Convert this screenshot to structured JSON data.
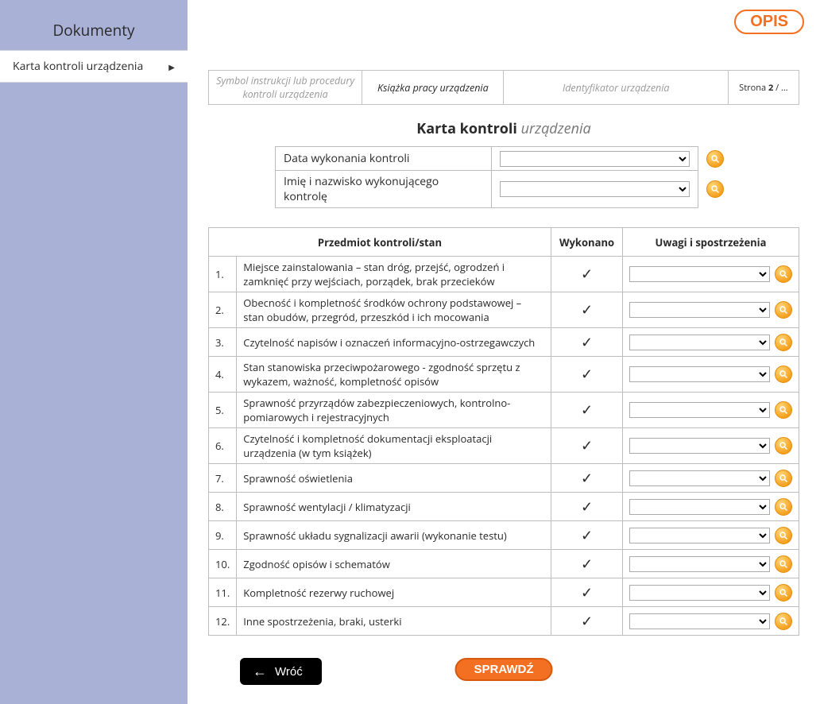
{
  "sidebar": {
    "title": "Dokumenty",
    "item": "Karta kontroli urządzenia"
  },
  "opis": "OPIS",
  "header_row": {
    "c1": "Symbol instrukcji lub procedury kontroli urządzenia",
    "c2": "Książka pracy urządzenia",
    "c3": "Identyfikator urządzenia",
    "c4_pre": "Strona ",
    "c4_b": "2",
    "c4_post": " / ..."
  },
  "title_row": {
    "bold": "Karta kontroli",
    "em": "urządzenia"
  },
  "meta": {
    "r1": "Data wykonania kontroli",
    "r2": "Imię i nazwisko wykonującego kontrolę"
  },
  "table": {
    "h1": "Przedmiot kontroli/stan",
    "h2": "Wykonano",
    "h3": "Uwagi i spostrzeżenia",
    "rows": [
      {
        "n": "1.",
        "t": "Miejsce zainstalowania – stan dróg, przejść, ogrodzeń i zamknięć przy wejściach, porządek, brak przecieków"
      },
      {
        "n": "2.",
        "t": "Obecność i kompletność środków ochrony podstawowej – stan obudów, przegród, przeszkód i ich mocowania"
      },
      {
        "n": "3.",
        "t": "Czytelność napisów i oznaczeń informacyjno-ostrzegawczych"
      },
      {
        "n": "4.",
        "t": "Stan stanowiska przeciwpożarowego - zgodność sprzętu z wykazem, ważność, kompletność opisów"
      },
      {
        "n": "5.",
        "t": "Sprawność przyrządów zabezpieczeniowych, kontrolno-pomiarowych i rejestracyjnych"
      },
      {
        "n": "6.",
        "t": "Czytelność i kompletność dokumentacji eksploatacji urządzenia (w tym książek)"
      },
      {
        "n": "7.",
        "t": "Sprawność oświetlenia"
      },
      {
        "n": "8.",
        "t": "Sprawność wentylacji / klimatyzacji"
      },
      {
        "n": "9.",
        "t": "Sprawność układu sygnalizacji awarii (wykonanie testu)"
      },
      {
        "n": "10.",
        "t": "Zgodność opisów i schematów"
      },
      {
        "n": "11.",
        "t": "Kompletność rezerwy ruchowej"
      },
      {
        "n": "12.",
        "t": "Inne spostrzeżenia, braki, usterki"
      }
    ]
  },
  "buttons": {
    "back": "Wróć",
    "check": "SPRAWDŹ"
  },
  "check_mark": "✓"
}
